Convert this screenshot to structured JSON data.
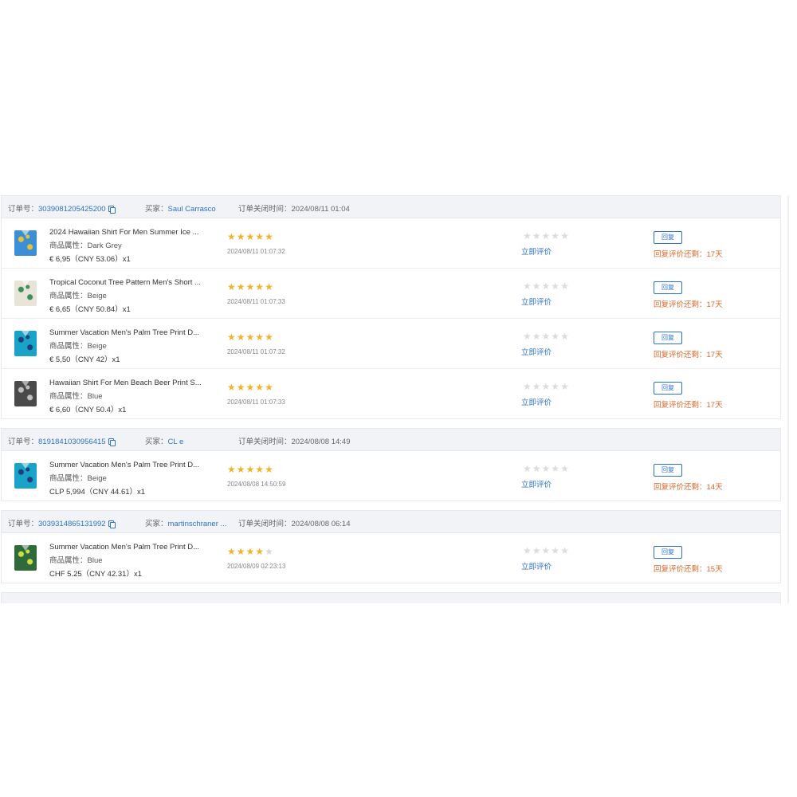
{
  "labels": {
    "order_no": "订单号：",
    "buyer": "买家：",
    "close_time": "订单关闭时间：",
    "attr": "商品属性：",
    "rate_now": "立即评价",
    "reply": "回复",
    "reply_remaining": "回复评价还剩："
  },
  "orders": [
    {
      "order_no": "3039081205425200",
      "buyer": "Saul Carrasco",
      "close_time": "2024/08/11 01:04",
      "items": [
        {
          "title": "2024 Hawaiian Shirt For Men Summer Ice ...",
          "attr": "Dark Grey",
          "price": "€ 6,95（CNY  53.06）x1",
          "rating": 5,
          "review_time": "2024/08/11 01:07:32",
          "days_left": "17天",
          "thumb_color": "#3c8fd6",
          "thumb_accent": "#e6c234"
        },
        {
          "title": "Tropical Coconut Tree Pattern Men's Short ...",
          "attr": "Beige",
          "price": "€ 6,65（CNY  50.84）x1",
          "rating": 5,
          "review_time": "2024/08/11 01:07:33",
          "days_left": "17天",
          "thumb_color": "#e8e4d8",
          "thumb_accent": "#3a8f5a"
        },
        {
          "title": "Summer Vacation Men's Palm Tree Print D...",
          "attr": "Beige",
          "price": "€ 5,50（CNY  42）x1",
          "rating": 5,
          "review_time": "2024/08/11 01:07:32",
          "days_left": "17天",
          "thumb_color": "#1aa3c8",
          "thumb_accent": "#1f3f7a"
        },
        {
          "title": "Hawaiian Shirt For Men Beach Beer Print S...",
          "attr": "Blue",
          "price": "€ 6,60（CNY  50.4）x1",
          "rating": 5,
          "review_time": "2024/08/11 01:07:33",
          "days_left": "17天",
          "thumb_color": "#4a4a4a",
          "thumb_accent": "#bfbfbf"
        }
      ]
    },
    {
      "order_no": "8191841030956415",
      "buyer": "CL e",
      "close_time": "2024/08/08 14:49",
      "items": [
        {
          "title": "Summer Vacation Men's Palm Tree Print D...",
          "attr": "Beige",
          "price": "CLP 5,994（CNY  44.61）x1",
          "rating": 5,
          "review_time": "2024/08/08 14:50:59",
          "days_left": "14天",
          "thumb_color": "#1aa3c8",
          "thumb_accent": "#1f3f7a"
        }
      ]
    },
    {
      "order_no": "3039314865131992",
      "buyer": "martinschraner ...",
      "close_time": "2024/08/08 06:14",
      "items": [
        {
          "title": "Summer Vacation Men's Palm Tree Print D...",
          "attr": "Blue",
          "price": "CHF 5.25（CNY  42.31）x1",
          "rating": 4,
          "review_time": "2024/08/09 02:23:13",
          "days_left": "15天",
          "thumb_color": "#2f6b3a",
          "thumb_accent": "#c9e04a"
        }
      ]
    }
  ]
}
